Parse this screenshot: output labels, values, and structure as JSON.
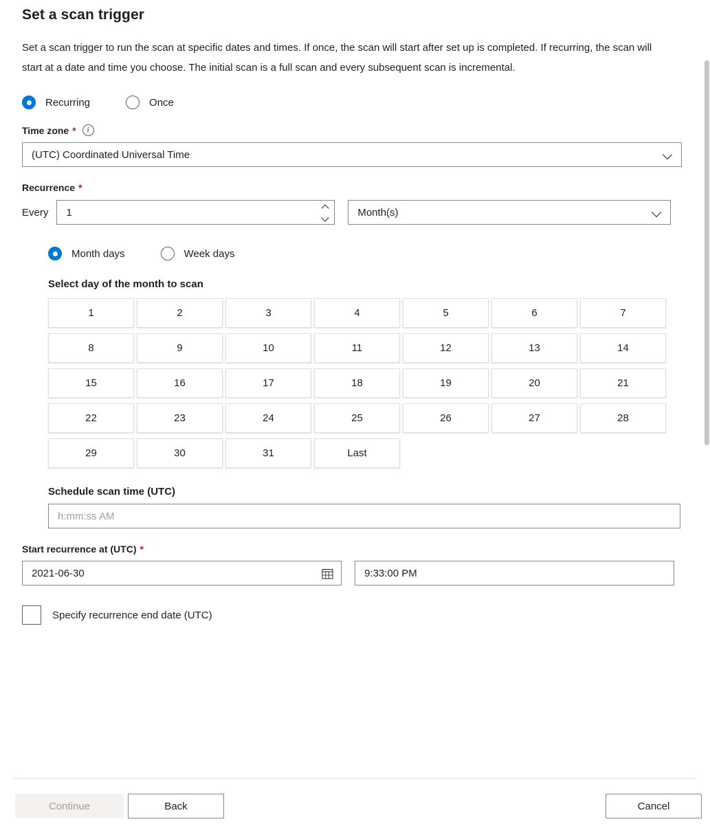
{
  "dialog": {
    "title": "Set a scan trigger",
    "description": "Set a scan trigger to run the scan at specific dates and times. If once, the scan will start after set up is completed. If recurring, the scan will start at a date and time you choose. The initial scan is a full scan and every subsequent scan is incremental."
  },
  "trigger_mode": {
    "recurring_label": "Recurring",
    "once_label": "Once",
    "selected": "Recurring"
  },
  "time_zone": {
    "label": "Time zone",
    "required_marker": "*",
    "info_glyph": "i",
    "value": "(UTC) Coordinated Universal Time"
  },
  "recurrence": {
    "label": "Recurrence",
    "required_marker": "*",
    "every_label": "Every",
    "interval_value": "1",
    "unit_value": "Month(s)",
    "mode": {
      "month_days_label": "Month days",
      "week_days_label": "Week days",
      "selected": "Month days"
    },
    "day_picker_label": "Select day of the month to scan",
    "days": [
      "1",
      "2",
      "3",
      "4",
      "5",
      "6",
      "7",
      "8",
      "9",
      "10",
      "11",
      "12",
      "13",
      "14",
      "15",
      "16",
      "17",
      "18",
      "19",
      "20",
      "21",
      "22",
      "23",
      "24",
      "25",
      "26",
      "27",
      "28",
      "29",
      "30",
      "31",
      "Last"
    ]
  },
  "schedule_time": {
    "label": "Schedule scan time (UTC)",
    "placeholder": "h:mm:ss AM",
    "value": ""
  },
  "start_recurrence": {
    "label": "Start recurrence at (UTC)",
    "required_marker": "*",
    "date_value": "2021-06-30",
    "time_value": "9:33:00 PM"
  },
  "end_date": {
    "checkbox_label": "Specify recurrence end date (UTC)",
    "checked": false
  },
  "footer": {
    "continue_label": "Continue",
    "back_label": "Back",
    "cancel_label": "Cancel"
  },
  "colors": {
    "accent": "#0078d4",
    "required": "#a4262c",
    "border": "#8a8886",
    "disabled_text": "#a19f9d"
  }
}
